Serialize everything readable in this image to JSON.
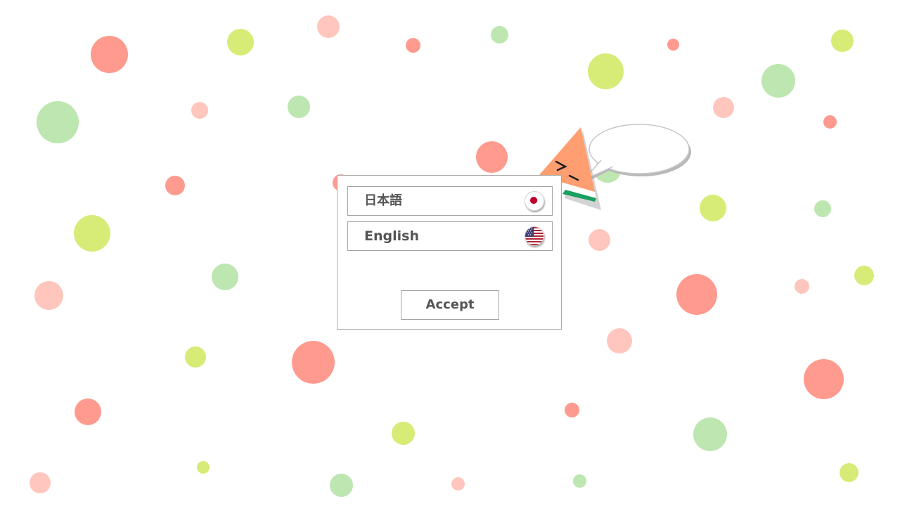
{
  "languages": [
    {
      "label": "日本語",
      "icon": "japan-flag-icon"
    },
    {
      "label": "English",
      "icon": "us-flag-icon"
    }
  ],
  "dialog": {
    "accept_label": "Accept"
  },
  "colors": {
    "dot_red": "#ff9a8e",
    "dot_pink": "#ffc6bd",
    "dot_green": "#bde6b0",
    "dot_lime": "#d6ec77",
    "text": "#555555",
    "border": "#a3a3a3"
  }
}
